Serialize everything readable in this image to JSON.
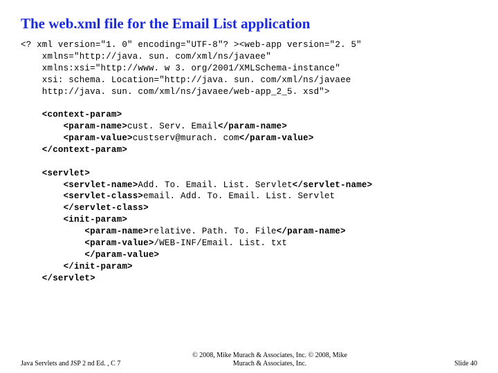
{
  "title": "The web.xml file for the Email List application",
  "code": {
    "l01": "<? xml version=\"1. 0\" encoding=\"UTF-8\"? ><web-app version=\"2. 5\"",
    "l02": "    xmlns=\"http://java. sun. com/xml/ns/javaee\"",
    "l03": "    xmlns:xsi=\"http://www. w 3. org/2001/XMLSchema-instance\"",
    "l04": "    xsi: schema. Location=\"http://java. sun. com/xml/ns/javaee",
    "l05": "    http://java. sun. com/xml/ns/javaee/web-app_2_5. xsd\">",
    "l06": "",
    "l07": "    <context-param>",
    "l08a": "        <param-name>",
    "l08b": "cust. Serv. Email",
    "l08c": "</param-name>",
    "l09a": "        <param-value>",
    "l09b": "custserv@murach. com",
    "l09c": "</param-value>",
    "l10": "    </context-param>",
    "l11": "",
    "l12": "    <servlet>",
    "l13a": "        <servlet-name>",
    "l13b": "Add. To. Email. List. Servlet",
    "l13c": "</servlet-name>",
    "l14a": "        <servlet-class>",
    "l14b": "email. Add. To. Email. List. Servlet",
    "l15": "        </servlet-class>",
    "l16": "        <init-param>",
    "l17a": "            <param-name>",
    "l17b": "relative. Path. To. File",
    "l17c": "</param-name>",
    "l18a": "            <param-value>",
    "l18b": "/WEB-INF/Email. List. txt",
    "l19": "            </param-value>",
    "l20": "        </init-param>",
    "l21": "    </servlet>"
  },
  "footer": {
    "left": "Java Servlets and JSP 2 nd Ed. , C 7",
    "center_line1": "© 2008, Mike Murach & Associates, Inc. © 2008, Mike",
    "center_line2": "Murach & Associates, Inc.",
    "right": "Slide 40"
  }
}
